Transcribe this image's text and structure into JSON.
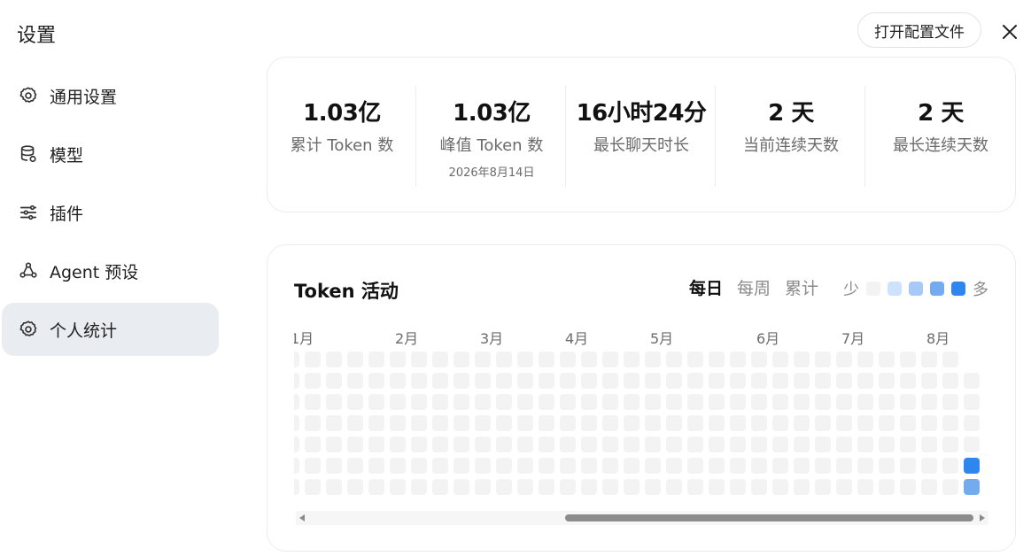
{
  "header": {
    "title": "设置",
    "open_config_label": "打开配置文件",
    "close_icon": "close-icon"
  },
  "sidebar": {
    "items": [
      {
        "label": "通用设置",
        "icon": "gear-icon",
        "active": false
      },
      {
        "label": "模型",
        "icon": "database-icon",
        "active": false
      },
      {
        "label": "插件",
        "icon": "sliders-icon",
        "active": false
      },
      {
        "label": "Agent 预设",
        "icon": "agent-icon",
        "active": false
      },
      {
        "label": "个人统计",
        "icon": "gear-icon",
        "active": true
      }
    ]
  },
  "stats": [
    {
      "value": "1.03亿",
      "label": "累计 Token 数",
      "sub": ""
    },
    {
      "value": "1.03亿",
      "label": "峰值 Token 数",
      "sub": "2026年8月14日"
    },
    {
      "value": "16小时24分",
      "label": "最长聊天时长",
      "sub": ""
    },
    {
      "value": "2 天",
      "label": "当前连续天数",
      "sub": ""
    },
    {
      "value": "2 天",
      "label": "最长连续天数",
      "sub": ""
    }
  ],
  "activity": {
    "title": "Token 活动",
    "tabs": [
      {
        "label": "每日",
        "active": true
      },
      {
        "label": "每周",
        "active": false
      },
      {
        "label": "累计",
        "active": false
      }
    ],
    "legend": {
      "less": "少",
      "more": "多",
      "colors": [
        "#f3f3f4",
        "#cfe2fb",
        "#a6c9f5",
        "#74abef",
        "#2e86ee"
      ]
    },
    "months": [
      "1月",
      "2月",
      "3月",
      "4月",
      "5月",
      "6月",
      "7月",
      "8月"
    ],
    "heat": {
      "columns": 33,
      "rows": 7,
      "empty_color": "#f3f3f4",
      "active_cells": [
        {
          "col": 32,
          "row": 5,
          "color": "#2e86ee"
        },
        {
          "col": 32,
          "row": 6,
          "color": "#74abef"
        }
      ],
      "missing_cells": [
        {
          "col": 32,
          "row": 0
        }
      ]
    }
  }
}
